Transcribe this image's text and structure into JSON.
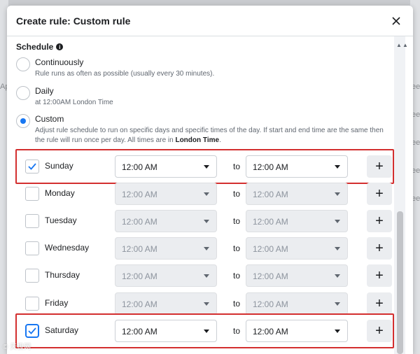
{
  "dialog": {
    "title": "Create rule: Custom rule"
  },
  "schedule": {
    "label": "Schedule",
    "info_icon": "i",
    "options": [
      {
        "title": "Continuously",
        "desc": "Rule runs as often as possible (usually every 30 minutes).",
        "selected": false
      },
      {
        "title": "Daily",
        "desc": "at 12:00AM London Time",
        "selected": false
      },
      {
        "title": "Custom",
        "desc": "Adjust rule schedule to run on specific days and specific times of the day. If start and end time are the same then the rule will run once per day. All times are in",
        "desc_bold": "London Time",
        "desc_end": ".",
        "selected": true
      }
    ]
  },
  "days": [
    {
      "day": "Sunday",
      "checked": true,
      "start": "12:00 AM",
      "end": "12:00 AM",
      "to": "to",
      "add": "+"
    },
    {
      "day": "Monday",
      "checked": false,
      "start": "12:00 AM",
      "end": "12:00 AM",
      "to": "to",
      "add": "+"
    },
    {
      "day": "Tuesday",
      "checked": false,
      "start": "12:00 AM",
      "end": "12:00 AM",
      "to": "to",
      "add": "+"
    },
    {
      "day": "Wednesday",
      "checked": false,
      "start": "12:00 AM",
      "end": "12:00 AM",
      "to": "to",
      "add": "+"
    },
    {
      "day": "Thursday",
      "checked": false,
      "start": "12:00 AM",
      "end": "12:00 AM",
      "to": "to",
      "add": "+"
    },
    {
      "day": "Friday",
      "checked": false,
      "start": "12:00 AM",
      "end": "12:00 AM",
      "to": "to",
      "add": "+"
    },
    {
      "day": "Saturday",
      "checked": true,
      "start": "12:00 AM",
      "end": "12:00 AM",
      "to": "to",
      "add": "+"
    }
  ],
  "background": {
    "frag_left": "Ap",
    "frag_right": [
      "ee",
      "ee",
      "ee",
      "ee",
      "ee"
    ]
  },
  "colors": {
    "accent": "#1877f2",
    "highlight": "#d32f2f",
    "disabled_bg": "#ebedf0"
  },
  "watermark": "© 天极网"
}
